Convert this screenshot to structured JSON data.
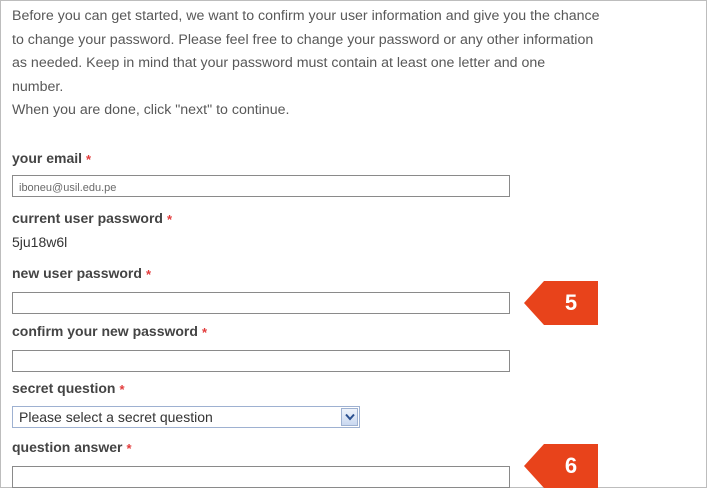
{
  "intro": {
    "lines": [
      "Before you can get started, we want to confirm your user information and give you the chance",
      "to change your password. Please feel free to change your password or any other information",
      "as needed. Keep in mind that your password must contain at least one letter and one",
      "number.",
      "When you are done, click \"next\" to continue."
    ]
  },
  "required_marker": "*",
  "form": {
    "email_label": "your email",
    "email_value": "iboneu@usil.edu.pe",
    "current_password_label": "current user password",
    "current_password_value": "5ju18w6l",
    "new_password_label": "new user password",
    "new_password_value": "",
    "confirm_password_label": "confirm your new password",
    "confirm_password_value": "",
    "secret_question_label": "secret question",
    "secret_question_selected": "Please select a secret question",
    "answer_label": "question answer",
    "answer_value": ""
  },
  "callouts": {
    "first": "5",
    "second": "6"
  },
  "colors": {
    "accent": "#e8431b",
    "required": "#e23b3b"
  },
  "icons": {
    "dropdown": "chevron-down-icon"
  }
}
